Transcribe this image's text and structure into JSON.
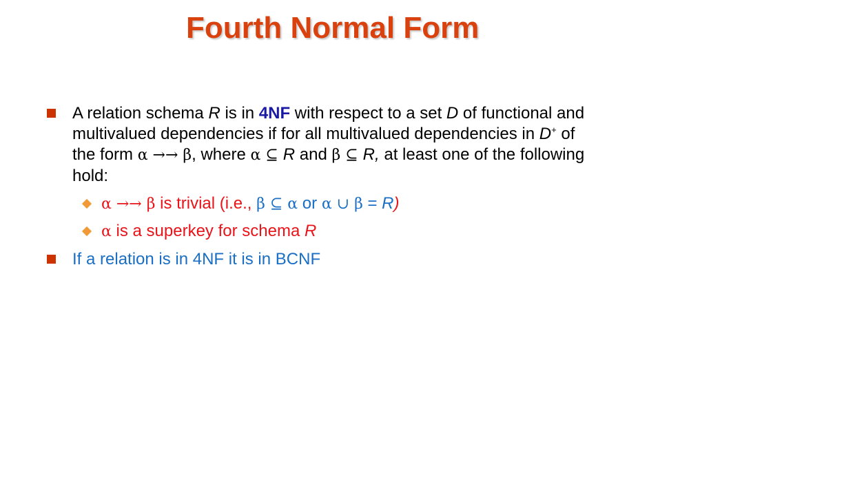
{
  "title": "Fourth Normal Form",
  "bullet1": {
    "l1_a": "A relation schema ",
    "l1_R": "R",
    "l1_b": " is in ",
    "l1_4nf": "4NF",
    "l1_c": " with respect to a set ",
    "l1_D": "D",
    "l1_d": " of functional and",
    "l2_a": "multivalued dependencies if for all multivalued dependencies in ",
    "l2_D": "D",
    "l2_plus": "+",
    "l2_b": " of",
    "l3_a": "the form ",
    "l3_expr": "α →→ β",
    "l3_b": ", where ",
    "l3_alpha_sub": "α ⊆ ",
    "l3_R1": "R",
    "l3_c": " and ",
    "l3_beta_sub": "β ⊆ ",
    "l3_R2": "R,",
    "l3_d": " at least one of the following",
    "l4": "hold:"
  },
  "sub1": {
    "expr": "α →→ β",
    "a": " is trivial (i.e., ",
    "beta_sub_alpha": "β ⊆ α",
    "or": " or ",
    "union": "α ∪ β",
    "eq": " = ",
    "R": "R",
    "close": ")"
  },
  "sub2": {
    "alpha": "α",
    "text": " is a superkey for schema ",
    "R": "R"
  },
  "bullet2": {
    "text": "If a relation is in 4NF it is in BCNF"
  },
  "colors": {
    "title": "#d9410f",
    "square_bullet": "#cc3300",
    "diamond_bullet": "#f29a38",
    "red_text": "#e8141a",
    "blue_text": "#1a6fc4",
    "keyword": "#1a1aa6"
  }
}
